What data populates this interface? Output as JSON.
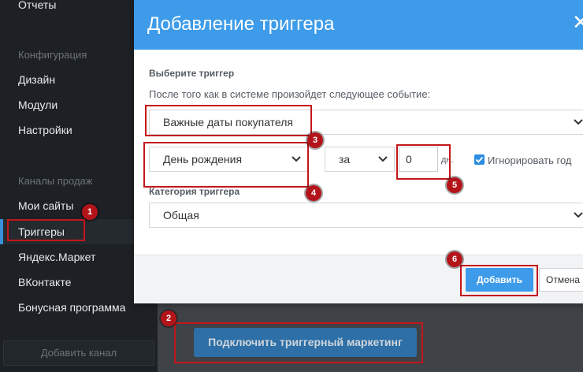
{
  "sidebar": {
    "reports": "Отчеты",
    "config_section": "Конфигурация",
    "design": "Дизайн",
    "modules": "Модули",
    "settings": "Настройки",
    "channels_section": "Каналы продаж",
    "my_sites": "Мои сайты",
    "triggers": "Триггеры",
    "yandex_market": "Яндекс.Маркет",
    "vkontakte": "ВКонтакте",
    "bonus": "Бонусная программа",
    "add_channel": "Добавить канал"
  },
  "main": {
    "connect_button": "Подключить триггерный маркетинг"
  },
  "modal": {
    "title": "Добавление триггера",
    "close": "✕",
    "section_title": "Выберите триггер",
    "description": "После того как в системе произойдет следующее событие:",
    "event_select": "Важные даты покупателя",
    "date_select": "День рождения",
    "offset_select": "за",
    "days_value": "0",
    "days_unit": "дн.",
    "ignore_year_label": "Игнорировать год",
    "ignore_year_checked": true,
    "category_label": "Категория триггера",
    "category_select": "Общая",
    "add_button": "Добавить",
    "cancel_button": "Отмена"
  },
  "annotations": [
    "1",
    "2",
    "3",
    "4",
    "5",
    "6"
  ],
  "colors": {
    "accent": "#3d9be9",
    "annotation": "#c4161c",
    "sidebar_bg": "#1d2125"
  }
}
